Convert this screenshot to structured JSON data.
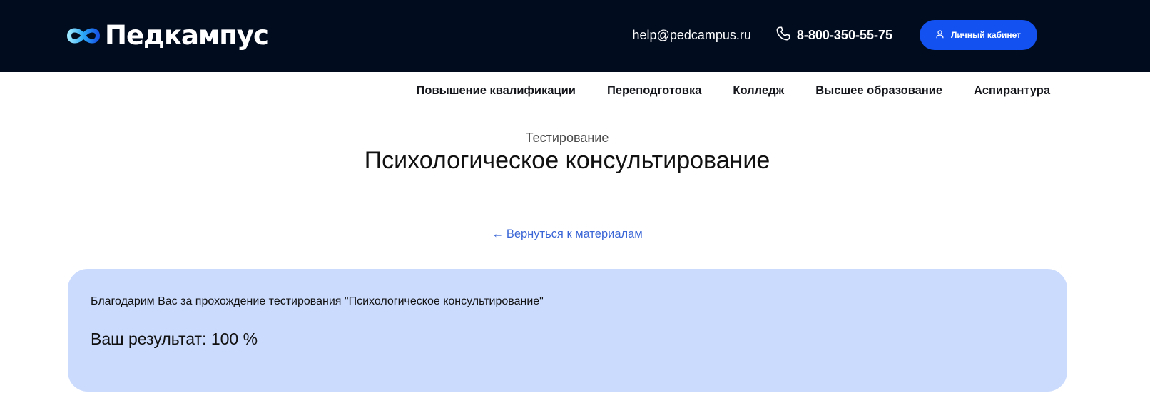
{
  "header": {
    "logo_text": "Педкампус",
    "logo_icon": "infinity-logo-icon",
    "email": "help@pedcampus.ru",
    "phone": "8-800-350-55-75",
    "phone_icon": "phone-icon",
    "cabinet_button": "Личный кабинет",
    "cabinet_icon": "user-icon"
  },
  "nav": {
    "items": [
      {
        "label": "Повышение квалификации"
      },
      {
        "label": "Переподготовка"
      },
      {
        "label": "Колледж"
      },
      {
        "label": "Высшее образование"
      },
      {
        "label": "Аспирантура"
      }
    ]
  },
  "page": {
    "subtitle": "Тестирование",
    "title": "Психологическое консультирование",
    "back_arrow": "←",
    "back_link": "Вернуться к материалам"
  },
  "result": {
    "thanks": "Благодарим Вас за прохождение тестирования \"Психологическое консультирование\"",
    "score_text": "Ваш результат: 100 %"
  },
  "colors": {
    "header_bg": "#020c1f",
    "accent": "#1352f1",
    "link": "#3a66d6",
    "result_bg": "#cbdbfd"
  }
}
